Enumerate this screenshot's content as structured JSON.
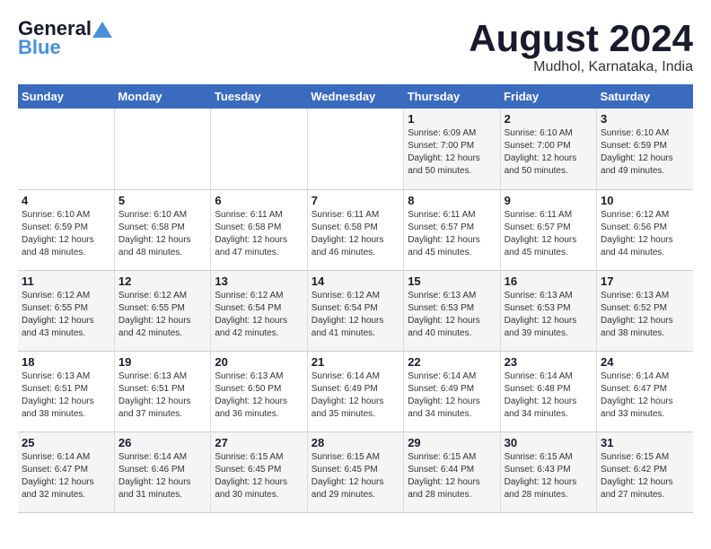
{
  "header": {
    "logo_line1": "General",
    "logo_line2": "Blue",
    "main_title": "August 2024",
    "subtitle": "Mudhol, Karnataka, India"
  },
  "weekdays": [
    "Sunday",
    "Monday",
    "Tuesday",
    "Wednesday",
    "Thursday",
    "Friday",
    "Saturday"
  ],
  "weeks": [
    [
      {
        "day": "",
        "info": ""
      },
      {
        "day": "",
        "info": ""
      },
      {
        "day": "",
        "info": ""
      },
      {
        "day": "",
        "info": ""
      },
      {
        "day": "1",
        "info": "Sunrise: 6:09 AM\nSunset: 7:00 PM\nDaylight: 12 hours\nand 50 minutes."
      },
      {
        "day": "2",
        "info": "Sunrise: 6:10 AM\nSunset: 7:00 PM\nDaylight: 12 hours\nand 50 minutes."
      },
      {
        "day": "3",
        "info": "Sunrise: 6:10 AM\nSunset: 6:59 PM\nDaylight: 12 hours\nand 49 minutes."
      }
    ],
    [
      {
        "day": "4",
        "info": "Sunrise: 6:10 AM\nSunset: 6:59 PM\nDaylight: 12 hours\nand 48 minutes."
      },
      {
        "day": "5",
        "info": "Sunrise: 6:10 AM\nSunset: 6:58 PM\nDaylight: 12 hours\nand 48 minutes."
      },
      {
        "day": "6",
        "info": "Sunrise: 6:11 AM\nSunset: 6:58 PM\nDaylight: 12 hours\nand 47 minutes."
      },
      {
        "day": "7",
        "info": "Sunrise: 6:11 AM\nSunset: 6:58 PM\nDaylight: 12 hours\nand 46 minutes."
      },
      {
        "day": "8",
        "info": "Sunrise: 6:11 AM\nSunset: 6:57 PM\nDaylight: 12 hours\nand 45 minutes."
      },
      {
        "day": "9",
        "info": "Sunrise: 6:11 AM\nSunset: 6:57 PM\nDaylight: 12 hours\nand 45 minutes."
      },
      {
        "day": "10",
        "info": "Sunrise: 6:12 AM\nSunset: 6:56 PM\nDaylight: 12 hours\nand 44 minutes."
      }
    ],
    [
      {
        "day": "11",
        "info": "Sunrise: 6:12 AM\nSunset: 6:55 PM\nDaylight: 12 hours\nand 43 minutes."
      },
      {
        "day": "12",
        "info": "Sunrise: 6:12 AM\nSunset: 6:55 PM\nDaylight: 12 hours\nand 42 minutes."
      },
      {
        "day": "13",
        "info": "Sunrise: 6:12 AM\nSunset: 6:54 PM\nDaylight: 12 hours\nand 42 minutes."
      },
      {
        "day": "14",
        "info": "Sunrise: 6:12 AM\nSunset: 6:54 PM\nDaylight: 12 hours\nand 41 minutes."
      },
      {
        "day": "15",
        "info": "Sunrise: 6:13 AM\nSunset: 6:53 PM\nDaylight: 12 hours\nand 40 minutes."
      },
      {
        "day": "16",
        "info": "Sunrise: 6:13 AM\nSunset: 6:53 PM\nDaylight: 12 hours\nand 39 minutes."
      },
      {
        "day": "17",
        "info": "Sunrise: 6:13 AM\nSunset: 6:52 PM\nDaylight: 12 hours\nand 38 minutes."
      }
    ],
    [
      {
        "day": "18",
        "info": "Sunrise: 6:13 AM\nSunset: 6:51 PM\nDaylight: 12 hours\nand 38 minutes."
      },
      {
        "day": "19",
        "info": "Sunrise: 6:13 AM\nSunset: 6:51 PM\nDaylight: 12 hours\nand 37 minutes."
      },
      {
        "day": "20",
        "info": "Sunrise: 6:13 AM\nSunset: 6:50 PM\nDaylight: 12 hours\nand 36 minutes."
      },
      {
        "day": "21",
        "info": "Sunrise: 6:14 AM\nSunset: 6:49 PM\nDaylight: 12 hours\nand 35 minutes."
      },
      {
        "day": "22",
        "info": "Sunrise: 6:14 AM\nSunset: 6:49 PM\nDaylight: 12 hours\nand 34 minutes."
      },
      {
        "day": "23",
        "info": "Sunrise: 6:14 AM\nSunset: 6:48 PM\nDaylight: 12 hours\nand 34 minutes."
      },
      {
        "day": "24",
        "info": "Sunrise: 6:14 AM\nSunset: 6:47 PM\nDaylight: 12 hours\nand 33 minutes."
      }
    ],
    [
      {
        "day": "25",
        "info": "Sunrise: 6:14 AM\nSunset: 6:47 PM\nDaylight: 12 hours\nand 32 minutes."
      },
      {
        "day": "26",
        "info": "Sunrise: 6:14 AM\nSunset: 6:46 PM\nDaylight: 12 hours\nand 31 minutes."
      },
      {
        "day": "27",
        "info": "Sunrise: 6:15 AM\nSunset: 6:45 PM\nDaylight: 12 hours\nand 30 minutes."
      },
      {
        "day": "28",
        "info": "Sunrise: 6:15 AM\nSunset: 6:45 PM\nDaylight: 12 hours\nand 29 minutes."
      },
      {
        "day": "29",
        "info": "Sunrise: 6:15 AM\nSunset: 6:44 PM\nDaylight: 12 hours\nand 28 minutes."
      },
      {
        "day": "30",
        "info": "Sunrise: 6:15 AM\nSunset: 6:43 PM\nDaylight: 12 hours\nand 28 minutes."
      },
      {
        "day": "31",
        "info": "Sunrise: 6:15 AM\nSunset: 6:42 PM\nDaylight: 12 hours\nand 27 minutes."
      }
    ]
  ]
}
